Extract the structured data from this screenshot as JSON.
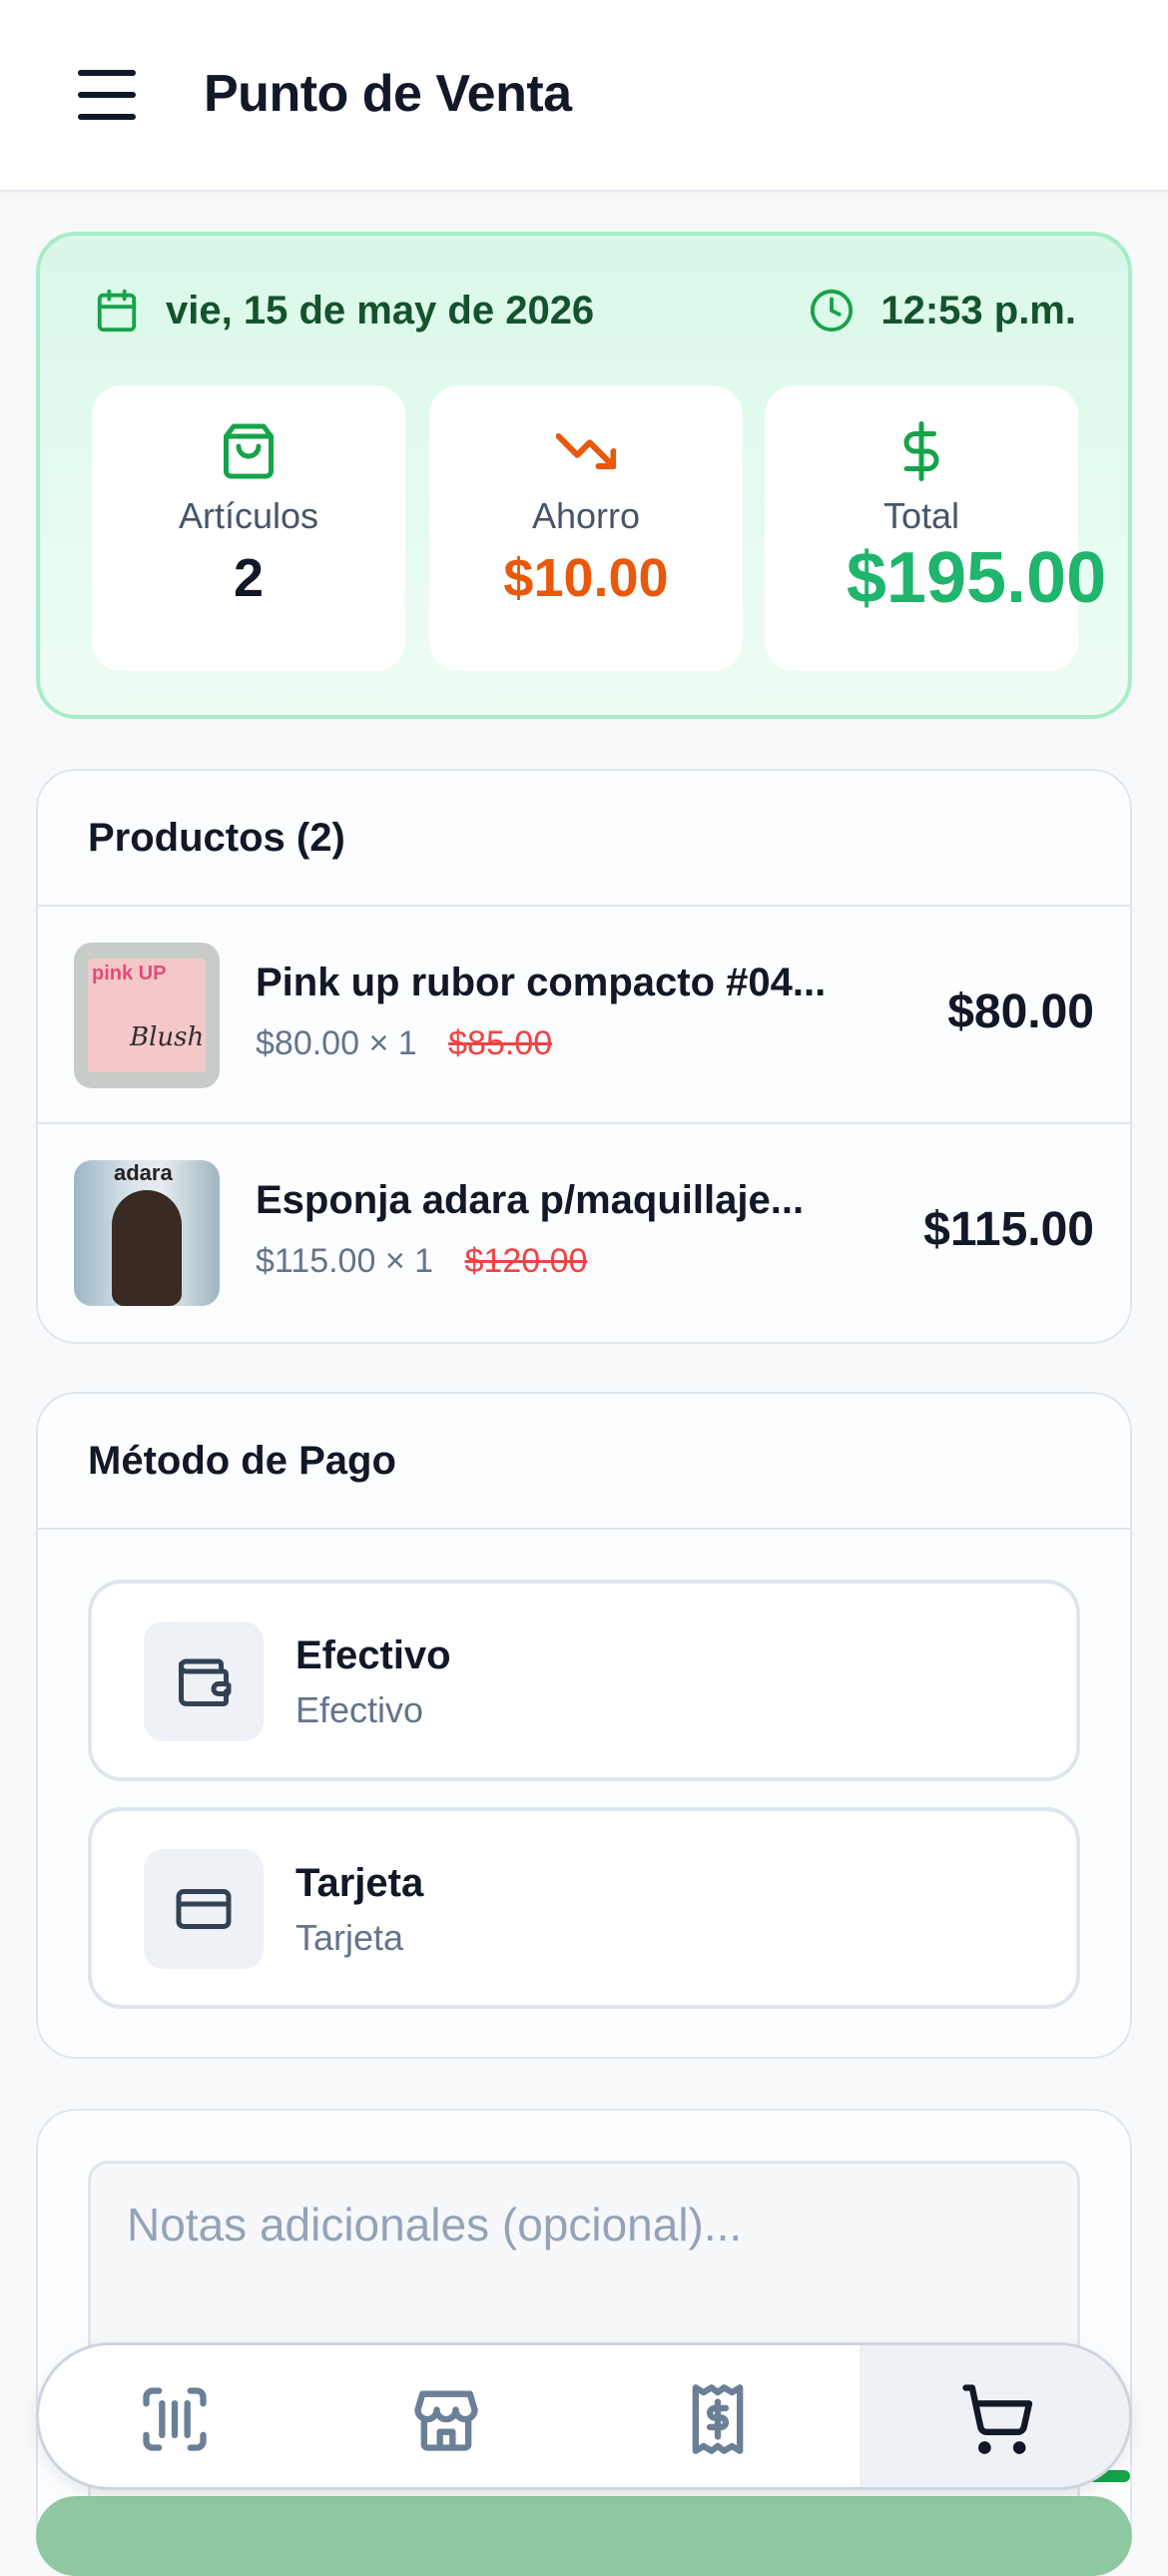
{
  "header": {
    "title": "Punto de Venta",
    "menu_icon": "menu-icon"
  },
  "summary": {
    "date": "vie, 15 de may de 2026",
    "time": "12:53 p.m.",
    "stats": {
      "items": {
        "label": "Artículos",
        "value": "2",
        "icon": "shopping-bag-icon"
      },
      "savings": {
        "label": "Ahorro",
        "value": "$10.00",
        "icon": "trending-down-icon"
      },
      "total": {
        "label": "Total",
        "value": "$195.00",
        "icon": "dollar-icon"
      }
    },
    "colors": {
      "accent": "#1fb56c",
      "savings": "#ea580c",
      "border": "#a5edc8"
    }
  },
  "products": {
    "title": "Productos (2)",
    "items": [
      {
        "name": "Pink up rubor compacto #04...",
        "unit_price": "$80.00",
        "qty": "× 1",
        "original_price": "$85.00",
        "total": "$80.00",
        "thumb_brand": "pink UP",
        "thumb_script": "Blush"
      },
      {
        "name": "Esponja adara p/maquillaje...",
        "unit_price": "$115.00",
        "qty": "× 1",
        "original_price": "$120.00",
        "total": "$115.00",
        "thumb_brand": "adara"
      }
    ]
  },
  "payment": {
    "title": "Método de Pago",
    "options": [
      {
        "title": "Efectivo",
        "subtitle": "Efectivo",
        "icon": "wallet-icon"
      },
      {
        "title": "Tarjeta",
        "subtitle": "Tarjeta",
        "icon": "credit-card-icon"
      }
    ]
  },
  "notes": {
    "placeholder": "Notas adicionales (opcional)..."
  },
  "nav": {
    "items": [
      {
        "icon": "barcode-scan-icon",
        "active": false
      },
      {
        "icon": "store-icon",
        "active": false
      },
      {
        "icon": "receipt-dollar-icon",
        "active": false
      },
      {
        "icon": "cart-icon",
        "active": true
      }
    ]
  }
}
